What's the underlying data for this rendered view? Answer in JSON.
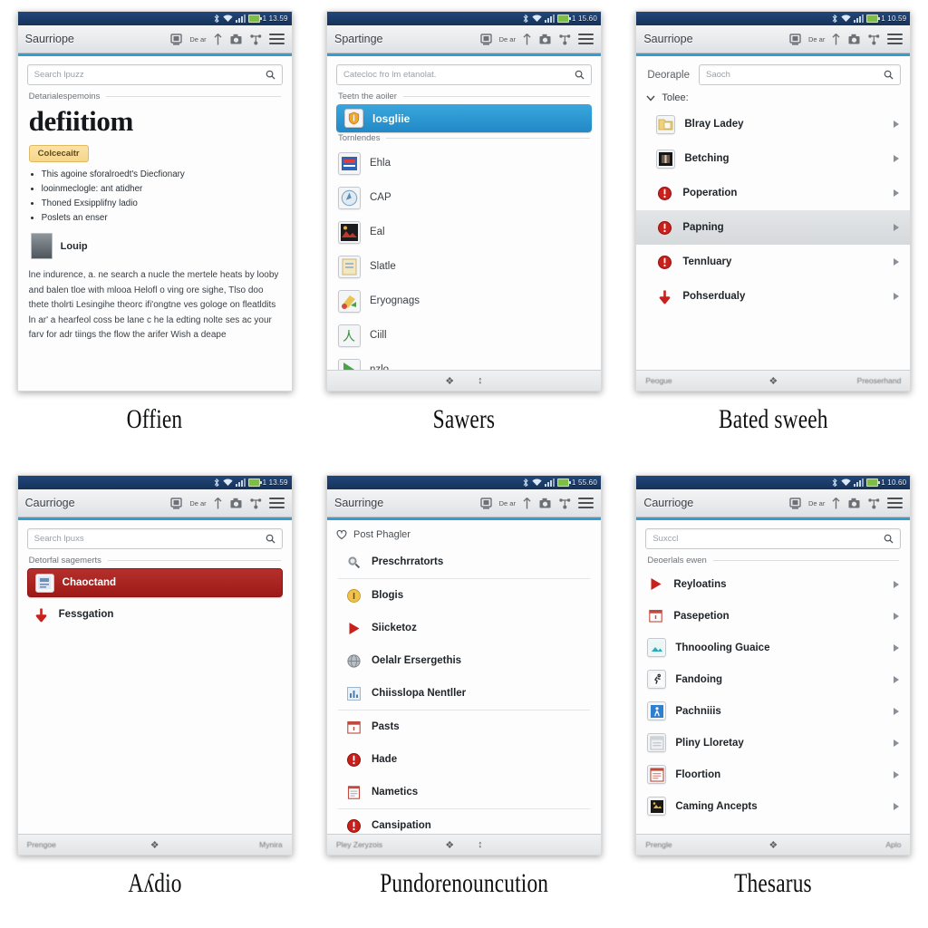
{
  "panels": [
    {
      "caption": "Offien",
      "status": {
        "time": "1 13.59",
        "icons": [
          "bluetooth-icon",
          "wifi-icon",
          "signal-icon",
          "battery-icon"
        ]
      },
      "actionbar": {
        "title": "Saurriope",
        "icon_text": "De ar",
        "icons": [
          "display-icon",
          "upload-icon",
          "camera-icon",
          "share-icon",
          "menu-icon"
        ]
      },
      "search": {
        "placeholder": "Search lpuzz"
      },
      "section": "Detarialespemoins",
      "headword": "defiitiom",
      "badge": "Colcecaitr",
      "bullets": [
        "This agoine sforalroedt's Diecfionary",
        "looinmeclogle: ant atidher",
        "Thoned Exsipplifny ladio",
        "Poslets an enser"
      ],
      "thumb_label": "Louip",
      "paragraph": "lne indurence, a. ne search a nucle the mertele heats by looby and balen tloe with mlooa Helofl o ving ore sighe, Tlso doo thete tholrti Lesingihe theorc ifi'ongtne ves gologe on fleatldits ln ar' a hearfeol coss be lane c he la edting nolte ses ac your farv for adr tiings the flow the arifer Wish a deape"
    },
    {
      "caption": "Sawers",
      "status": {
        "time": "1 15.60"
      },
      "actionbar": {
        "title": "Spartinge",
        "icon_text": "De ar"
      },
      "search": {
        "placeholder": "Catecloc fro lm etanolat."
      },
      "section_a": "Teetn the aoiler",
      "selected": "losgliie",
      "section_b": "Tornlendes",
      "items": [
        {
          "label": "Ehla",
          "icon": "news-app-icon"
        },
        {
          "label": "CAP",
          "icon": "compass-app-icon"
        },
        {
          "label": "Eal",
          "icon": "photo-app-icon"
        },
        {
          "label": "Slatle",
          "icon": "note-app-icon"
        },
        {
          "label": "Eryognags",
          "icon": "paint-app-icon"
        },
        {
          "label": "Ciill",
          "icon": "translate-app-icon"
        },
        {
          "label": "nzlo",
          "icon": "play-app-icon"
        }
      ],
      "bottombar": {
        "left": "",
        "right": ""
      }
    },
    {
      "caption": "Bated sweeh",
      "status": {
        "time": "1 10.59"
      },
      "actionbar": {
        "title": "Saurriope",
        "icon_text": "De ar"
      },
      "header_label": "Deoraple",
      "search": {
        "placeholder": "Saoch"
      },
      "group": "Tolee:",
      "items": [
        {
          "label": "Blray Ladey",
          "icon": "folder-note-icon",
          "selected": false
        },
        {
          "label": "Betching",
          "icon": "dark-book-icon",
          "selected": false
        },
        {
          "label": "Poperation",
          "icon": "red-alert-icon",
          "selected": false
        },
        {
          "label": "Papning",
          "icon": "red-alert-icon",
          "selected": true
        },
        {
          "label": "Tennluary",
          "icon": "red-alert-icon",
          "selected": false
        },
        {
          "label": "Pohserdualy",
          "icon": "red-down-arrow-icon",
          "selected": false
        }
      ],
      "bottombar": {
        "left": "Peogue",
        "right": "Preoserhand"
      }
    },
    {
      "caption": "Aʎdio",
      "status": {
        "time": "1 13.59"
      },
      "actionbar": {
        "title": "Caurrioge",
        "icon_text": "De ar"
      },
      "search": {
        "placeholder": "Search lpuxs"
      },
      "section": "Detorfal sagemerts",
      "selected": "Chaoctand",
      "items": [
        {
          "label": "Fessgation",
          "icon": "red-down-arrow-icon"
        }
      ],
      "bottombar": {
        "left": "Prengoe",
        "right": "Mynira"
      }
    },
    {
      "caption": "Pundorenouncution",
      "status": {
        "time": "1 55.60"
      },
      "actionbar": {
        "title": "Saurringe",
        "icon_text": "De ar"
      },
      "group": "Post Phagler",
      "items": [
        {
          "label": "Preschrratorts",
          "icon": "search-gear-icon",
          "rule_after": true
        },
        {
          "label": "Blogis",
          "icon": "yellow-info-icon",
          "rule_after": false
        },
        {
          "label": "Siicketoz",
          "icon": "red-play-icon",
          "rule_after": false
        },
        {
          "label": "Oelalr Ersergethis",
          "icon": "grey-globe-icon",
          "rule_after": false
        },
        {
          "label": "Chiisslopa Nentller",
          "icon": "blue-chart-icon",
          "rule_after": true
        },
        {
          "label": "Pasts",
          "icon": "calendar-icon",
          "rule_after": false
        },
        {
          "label": "Hade",
          "icon": "red-alert-icon",
          "rule_after": false
        },
        {
          "label": "Nametics",
          "icon": "list-doc-icon",
          "rule_after": true
        },
        {
          "label": "Cansipation",
          "icon": "red-alert-icon",
          "rule_after": false
        }
      ],
      "bottombar": {
        "left": "Pley Zeryzois",
        "right": ""
      }
    },
    {
      "caption": "Thesarus",
      "status": {
        "time": "1 10.60"
      },
      "actionbar": {
        "title": "Caurrioge",
        "icon_text": "De ar"
      },
      "search": {
        "placeholder": "Suxccl"
      },
      "section": "Deoerlals ewen",
      "items": [
        {
          "label": "Reyloatins",
          "icon": "red-play-icon"
        },
        {
          "label": "Pasepetion",
          "icon": "calendar-icon"
        },
        {
          "label": "Thnoooling Guaice",
          "icon": "teal-image-icon"
        },
        {
          "label": "Fandoing",
          "icon": "runner-icon"
        },
        {
          "label": "Pachniiis",
          "icon": "blue-person-icon"
        },
        {
          "label": "Pliny Lloretay",
          "icon": "grey-book-icon"
        },
        {
          "label": "Floortion",
          "icon": "red-list-icon"
        },
        {
          "label": "Caming Ancepts",
          "icon": "dark-media-icon"
        }
      ],
      "bottombar": {
        "left": "Prengle",
        "right": "Aplo"
      }
    }
  ],
  "colors": {
    "statusbar": "#1d3f68",
    "accent": "#2f9ed4",
    "selected_blue": "#2189c6",
    "selected_red": "#9d1a18",
    "badge": "#f6d68c"
  }
}
